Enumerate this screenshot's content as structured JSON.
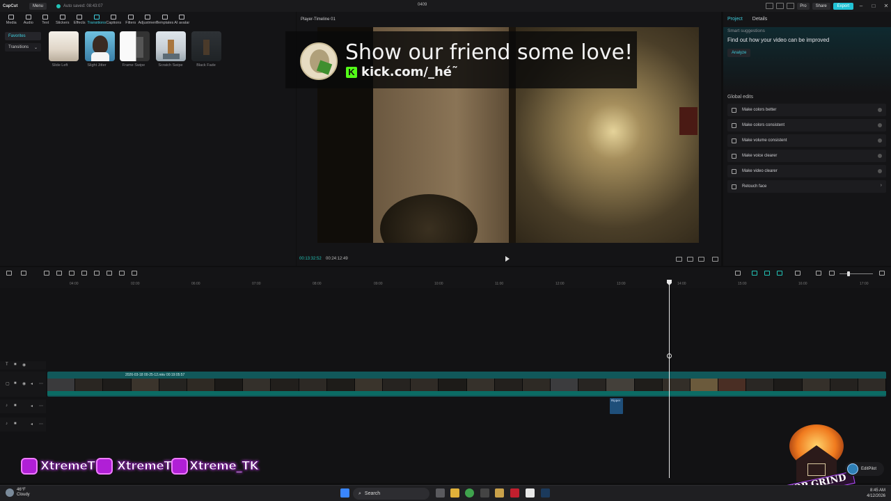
{
  "titlebar": {
    "logo": "CapCut",
    "menu": "Menu",
    "autosave": "Auto saved: 08:43:07",
    "window_title": "0409",
    "pro": "Pro",
    "share": "Share",
    "export": "Export"
  },
  "toolbar": {
    "items": [
      "Media",
      "Audio",
      "Text",
      "Stickers",
      "Effects",
      "Transitions",
      "Captions",
      "Filters",
      "Adjustment",
      "Templates",
      "AI avatar"
    ],
    "active": "Transitions"
  },
  "left_panel": {
    "favorites": "Favorites",
    "category": "Transitions",
    "thumbnails": [
      "Slide Left",
      "Slight Jitter",
      "Frame Swipe",
      "Scratch Swipe",
      "Black Fade"
    ]
  },
  "player": {
    "title": "Player-Timeline 01",
    "overlay_line1": "Show our friend some love!",
    "overlay_line2": "kick.com/_hé˜",
    "kick_badge": "K",
    "current_time": "00:13:32:52",
    "total_time": "00:24:12:49"
  },
  "right_panel": {
    "tabs": [
      "Project",
      "Details"
    ],
    "active_tab": "Project",
    "smart_label": "Smart suggestions",
    "smart_sub": "Find out how your video can be improved",
    "analyze": "Analyze",
    "global_label": "Global edits",
    "global_items": [
      "Make colors better",
      "Make colors consistent",
      "Make volume consistent",
      "Make voice clearer",
      "Make video clearer",
      "Retouch face"
    ]
  },
  "timeline": {
    "ticks": [
      "04:00",
      "02:00",
      "06:00",
      "07:00",
      "08:00",
      "09:00",
      "10:00",
      "11:00",
      "12:00",
      "13:00",
      "14:00",
      "15:00",
      "16:00",
      "17:00"
    ],
    "clip_label": "2026-03-18 00-25-12.mkv  00:19:05:57",
    "audio_clip": "Ripper"
  },
  "overlays": {
    "social": [
      "XtremeTK",
      "XtremeTK",
      "Xtreme_TK"
    ],
    "editpilot": "EditPilot",
    "crest_text": "TOP GRIND"
  },
  "taskbar": {
    "temp": "46°F",
    "weather": "Cloudy",
    "search": "Search",
    "time": "8:45 AM",
    "date": "4/12/2026"
  },
  "colors": {
    "accent": "#22c3d6",
    "clip": "#11585a",
    "bg": "#0e0e0f"
  }
}
